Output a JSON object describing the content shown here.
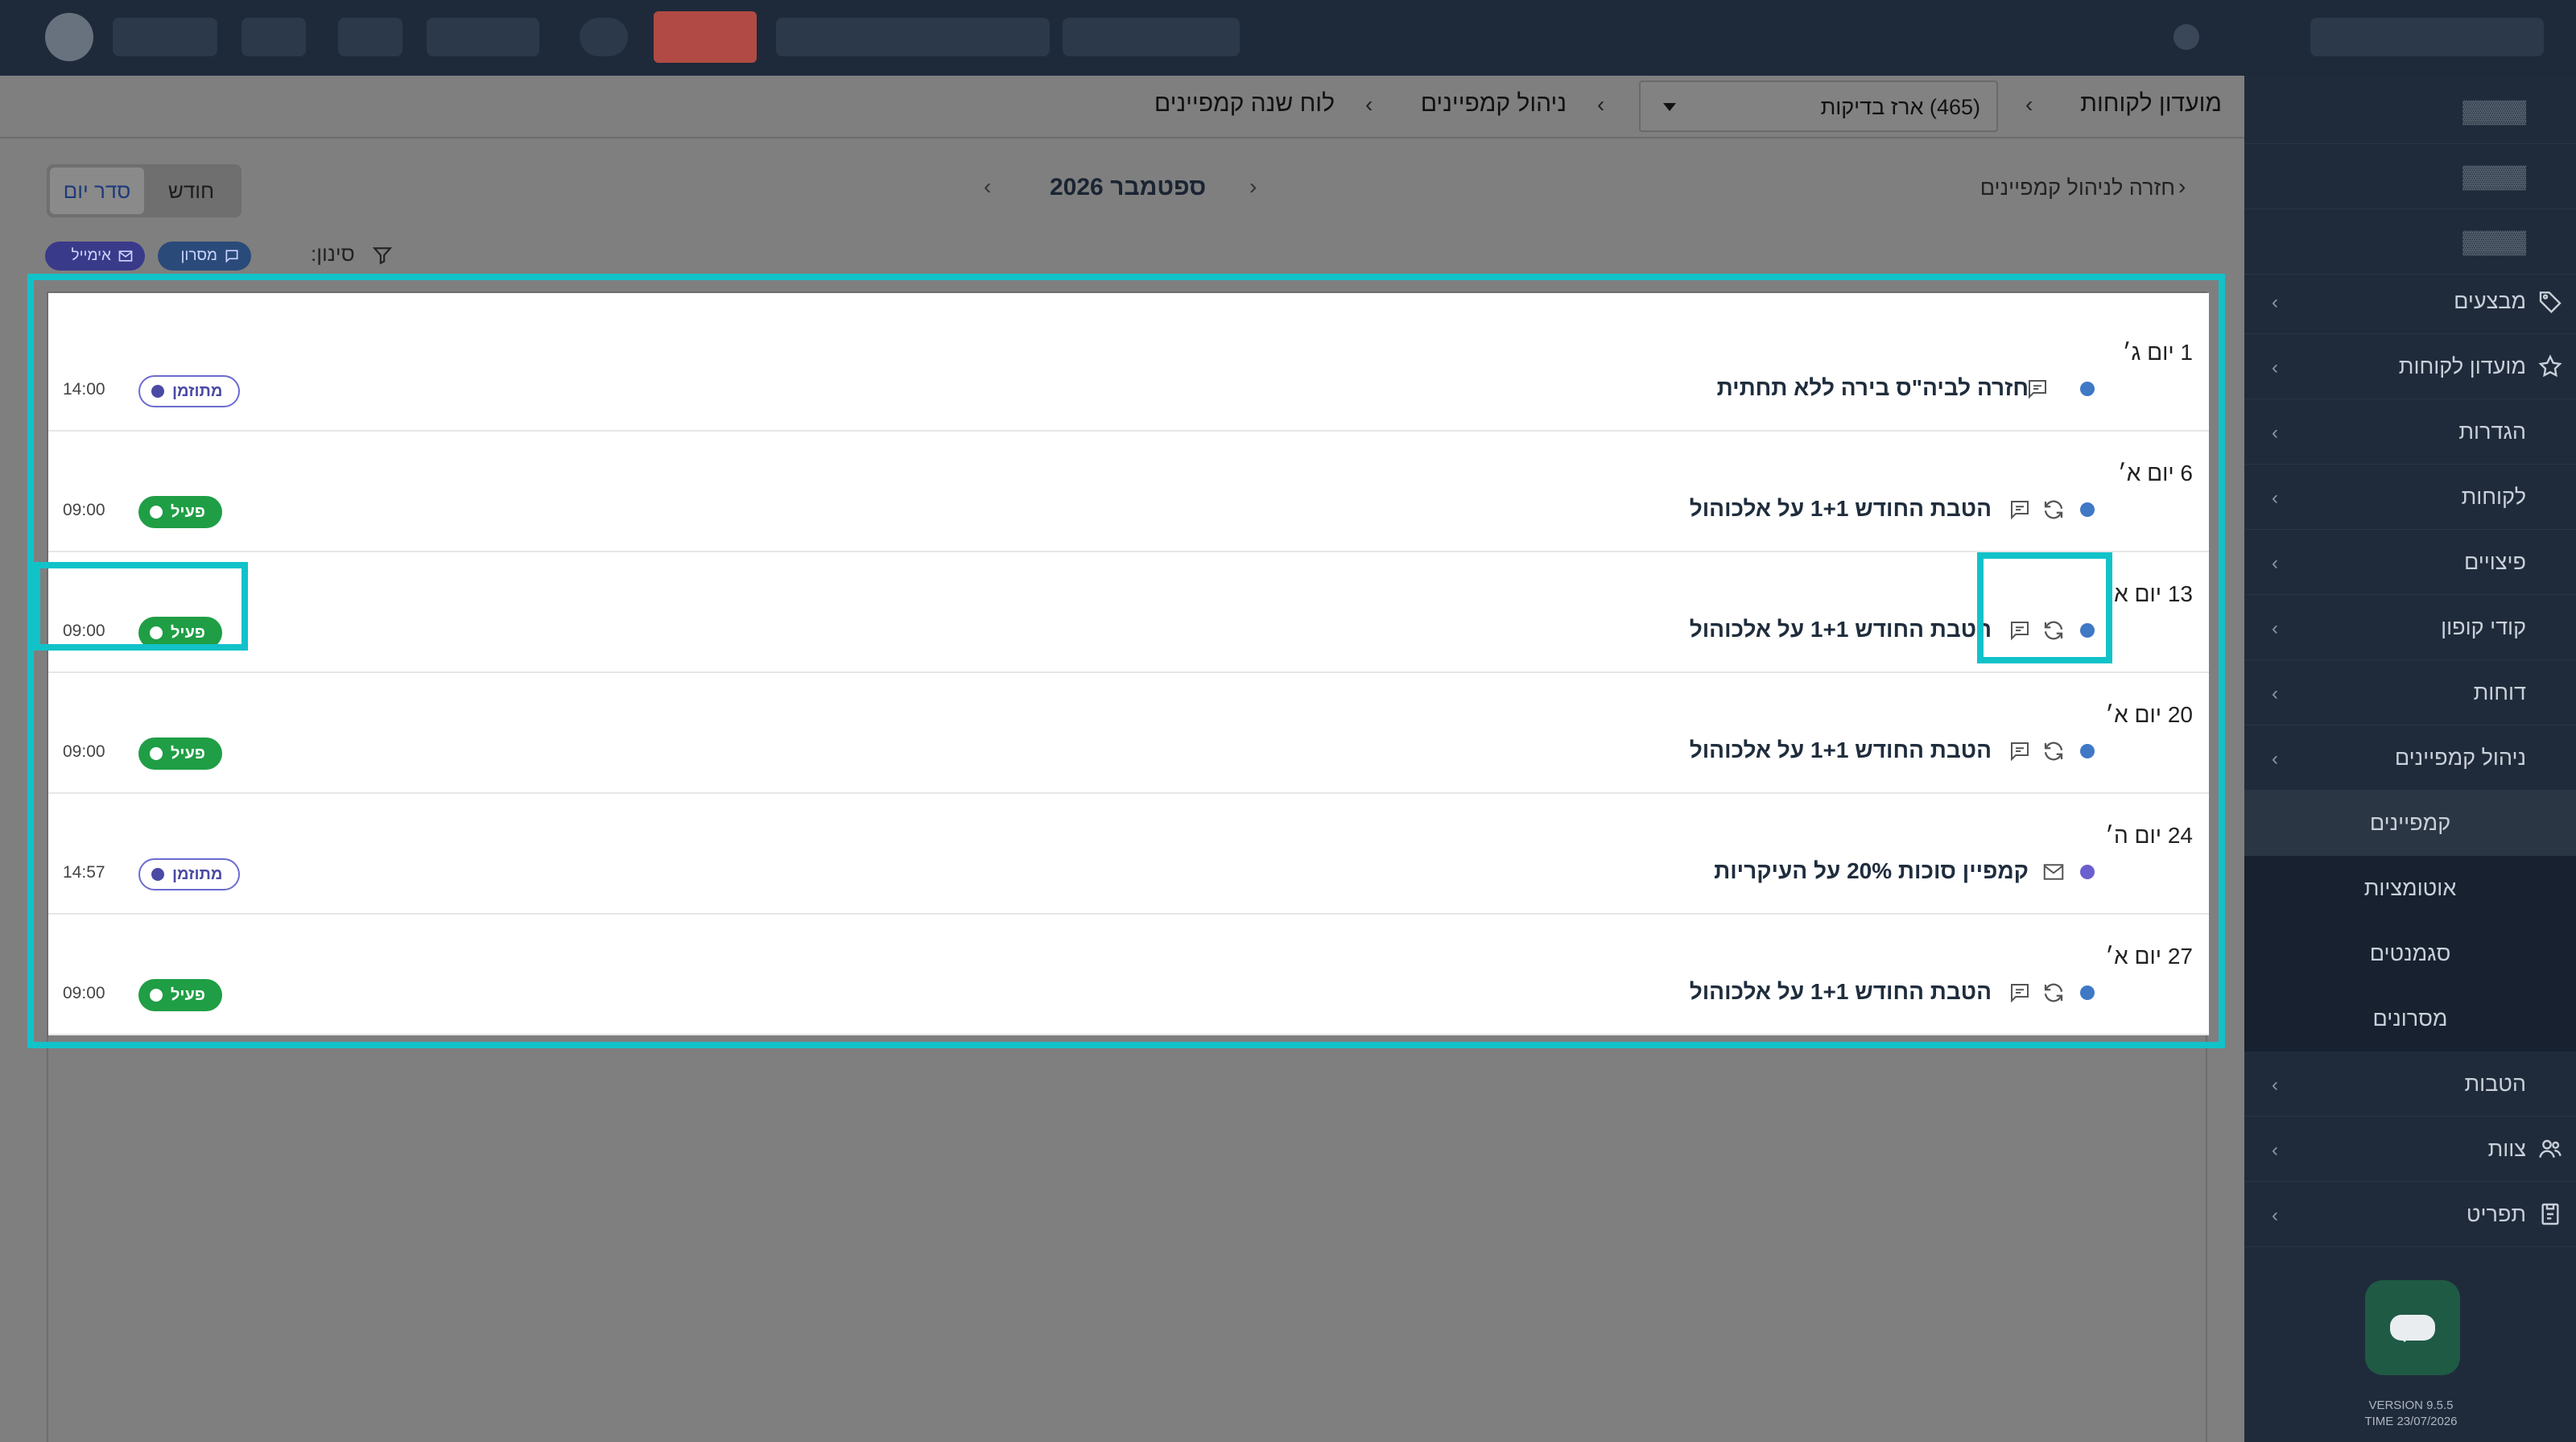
{
  "sidebar": {
    "items": [
      {
        "label": "מבצעים",
        "icon": "tag-icon",
        "chevron": true
      },
      {
        "label": "מועדון לקוחות",
        "icon": "star-icon",
        "chevron": true
      },
      {
        "label": "הגדרות",
        "chevron": true
      },
      {
        "label": "לקוחות",
        "chevron": true
      },
      {
        "label": "פיצויים",
        "chevron": true
      },
      {
        "label": "קודי קופון",
        "chevron": true
      },
      {
        "label": "דוחות",
        "chevron": true
      },
      {
        "label": "ניהול קמפיינים",
        "chevron": true
      },
      {
        "label": "קמפיינים",
        "sub": true,
        "active": true
      },
      {
        "label": "אוטומציות",
        "sub": true
      },
      {
        "label": "סגמנטים",
        "sub": true
      },
      {
        "label": "מסרונים",
        "sub": true
      },
      {
        "label": "הטבות",
        "chevron": true
      },
      {
        "label": "צוות",
        "icon": "people-icon",
        "chevron": true
      },
      {
        "label": "תפריט",
        "icon": "menu-book-icon",
        "chevron": true
      }
    ],
    "version": "VERSION 9.5.5",
    "time": "TIME 23/07/2026"
  },
  "breadcrumbs": {
    "root": "מועדון לקוחות",
    "store_select": "(465) ארז בדיקות",
    "section": "ניהול קמפיינים",
    "page": "לוח שנה קמפיינים"
  },
  "toolbar": {
    "back_label": "חזרה לניהול קמפיינים",
    "month_title": "ספטמבר 2026",
    "view_month": "חודש",
    "view_day": "סדר יום",
    "filter_label": "סינון:",
    "chip_sms": "מסרון",
    "chip_email": "אימייל"
  },
  "events": [
    {
      "date": "1 יום ג׳",
      "title": "חזרה לביה\"ס בירה ללא תחתית",
      "recurring": false,
      "channel": "sms",
      "status": "מתוזמן",
      "status_type": "scheduled",
      "time": "14:00"
    },
    {
      "date": "6 יום א׳",
      "title": "הטבת החודש 1+1 על אלכוהול",
      "recurring": true,
      "channel": "sms",
      "status": "פעיל",
      "status_type": "active",
      "time": "09:00"
    },
    {
      "date": "13 יום א׳",
      "title": "הטבת החודש 1+1 על אלכוהול",
      "recurring": true,
      "channel": "sms",
      "status": "פעיל",
      "status_type": "active",
      "time": "09:00"
    },
    {
      "date": "20 יום א׳",
      "title": "הטבת החודש 1+1 על אלכוהול",
      "recurring": true,
      "channel": "sms",
      "status": "פעיל",
      "status_type": "active",
      "time": "09:00"
    },
    {
      "date": "24 יום ה׳",
      "title": "קמפיין סוכות 20% על העיקריות",
      "recurring": false,
      "channel": "email",
      "status": "מתוזמן",
      "status_type": "scheduled",
      "time": "14:57"
    },
    {
      "date": "27 יום א׳",
      "title": "הטבת החודש 1+1 על אלכוהול",
      "recurring": true,
      "channel": "sms",
      "status": "פעיל",
      "status_type": "active",
      "time": "09:00"
    }
  ],
  "colors": {
    "highlight": "#12c2c9",
    "active_badge": "#1f9e45",
    "scheduled_badge": "#4a4aa5",
    "dot_sms": "#3f78c5",
    "dot_email": "#6b5fcf"
  }
}
